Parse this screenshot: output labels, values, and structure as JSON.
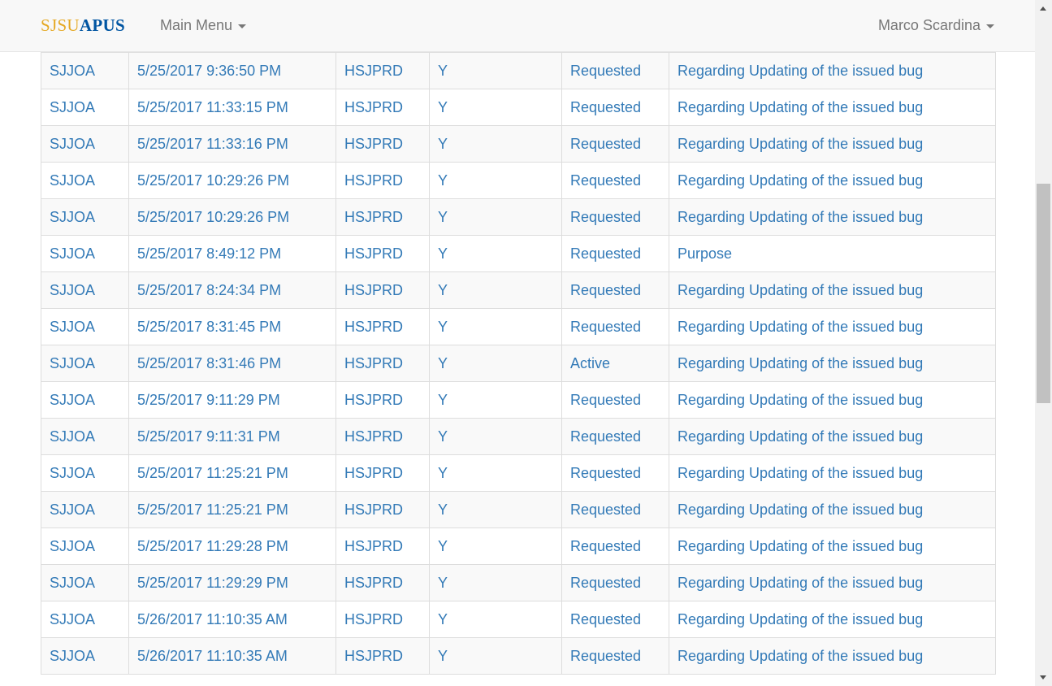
{
  "brand": {
    "part1": "SJSU",
    "part2": "APUS"
  },
  "nav": {
    "main_menu": "Main Menu",
    "user": "Marco Scardina"
  },
  "colors": {
    "link": "#337ab7",
    "brand_gold": "#e5a823",
    "brand_blue": "#0055a2",
    "navbar_bg": "#f8f8f8"
  },
  "icons": {
    "dropdown": "caret-down-icon"
  },
  "rows": [
    [
      "SJJOA",
      "5/25/2017 9:36:50 PM",
      "HSJPRD",
      "Y",
      "Requested",
      "Regarding Updating of the issued bug"
    ],
    [
      "SJJOA",
      "5/25/2017 11:33:15 PM",
      "HSJPRD",
      "Y",
      "Requested",
      "Regarding Updating of the issued bug"
    ],
    [
      "SJJOA",
      "5/25/2017 11:33:16 PM",
      "HSJPRD",
      "Y",
      "Requested",
      "Regarding Updating of the issued bug"
    ],
    [
      "SJJOA",
      "5/25/2017 10:29:26 PM",
      "HSJPRD",
      "Y",
      "Requested",
      "Regarding Updating of the issued bug"
    ],
    [
      "SJJOA",
      "5/25/2017 10:29:26 PM",
      "HSJPRD",
      "Y",
      "Requested",
      "Regarding Updating of the issued bug"
    ],
    [
      "SJJOA",
      "5/25/2017 8:49:12 PM",
      "HSJPRD",
      "Y",
      "Requested",
      "Purpose"
    ],
    [
      "SJJOA",
      "5/25/2017 8:24:34 PM",
      "HSJPRD",
      "Y",
      "Requested",
      "Regarding Updating of the issued bug"
    ],
    [
      "SJJOA",
      "5/25/2017 8:31:45 PM",
      "HSJPRD",
      "Y",
      "Requested",
      "Regarding Updating of the issued bug"
    ],
    [
      "SJJOA",
      "5/25/2017 8:31:46 PM",
      "HSJPRD",
      "Y",
      "Active",
      "Regarding Updating of the issued bug"
    ],
    [
      "SJJOA",
      "5/25/2017 9:11:29 PM",
      "HSJPRD",
      "Y",
      "Requested",
      "Regarding Updating of the issued bug"
    ],
    [
      "SJJOA",
      "5/25/2017 9:11:31 PM",
      "HSJPRD",
      "Y",
      "Requested",
      "Regarding Updating of the issued bug"
    ],
    [
      "SJJOA",
      "5/25/2017 11:25:21 PM",
      "HSJPRD",
      "Y",
      "Requested",
      "Regarding Updating of the issued bug"
    ],
    [
      "SJJOA",
      "5/25/2017 11:25:21 PM",
      "HSJPRD",
      "Y",
      "Requested",
      "Regarding Updating of the issued bug"
    ],
    [
      "SJJOA",
      "5/25/2017 11:29:28 PM",
      "HSJPRD",
      "Y",
      "Requested",
      "Regarding Updating of the issued bug"
    ],
    [
      "SJJOA",
      "5/25/2017 11:29:29 PM",
      "HSJPRD",
      "Y",
      "Requested",
      "Regarding Updating of the issued bug"
    ],
    [
      "SJJOA",
      "5/26/2017 11:10:35 AM",
      "HSJPRD",
      "Y",
      "Requested",
      "Regarding Updating of the issued bug"
    ],
    [
      "SJJOA",
      "5/26/2017 11:10:35 AM",
      "HSJPRD",
      "Y",
      "Requested",
      "Regarding Updating of the issued bug"
    ]
  ]
}
